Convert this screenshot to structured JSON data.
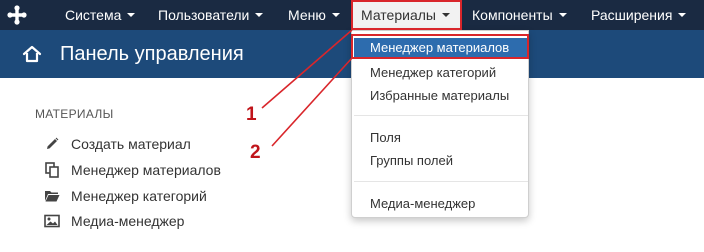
{
  "navbar": {
    "items": [
      {
        "label": "Система"
      },
      {
        "label": "Пользователи"
      },
      {
        "label": "Меню"
      },
      {
        "label": "Материалы"
      },
      {
        "label": "Компоненты"
      },
      {
        "label": "Расширения"
      }
    ]
  },
  "subheader": {
    "title": "Панель управления"
  },
  "sidebar": {
    "section_title": "МАТЕРИАЛЫ",
    "items": [
      {
        "label": "Создать материал",
        "icon": "pencil-icon"
      },
      {
        "label": "Менеджер материалов",
        "icon": "copy-icon"
      },
      {
        "label": "Менеджер категорий",
        "icon": "folder-open-icon"
      },
      {
        "label": "Медиа-менеджер",
        "icon": "image-icon"
      }
    ]
  },
  "dropdown": {
    "items": [
      {
        "label": "Менеджер материалов"
      },
      {
        "label": "Менеджер категорий"
      },
      {
        "label": "Избранные материалы"
      },
      {
        "label": "Поля"
      },
      {
        "label": "Группы полей"
      },
      {
        "label": "Медиа-менеджер"
      }
    ]
  },
  "annotations": {
    "step1": "1",
    "step2": "2"
  },
  "colors": {
    "navbar_bg": "#1a2a42",
    "subheader_bg": "#1d4a7a",
    "highlight_bg": "#2d6cae",
    "annotation_red": "#d9262b"
  }
}
